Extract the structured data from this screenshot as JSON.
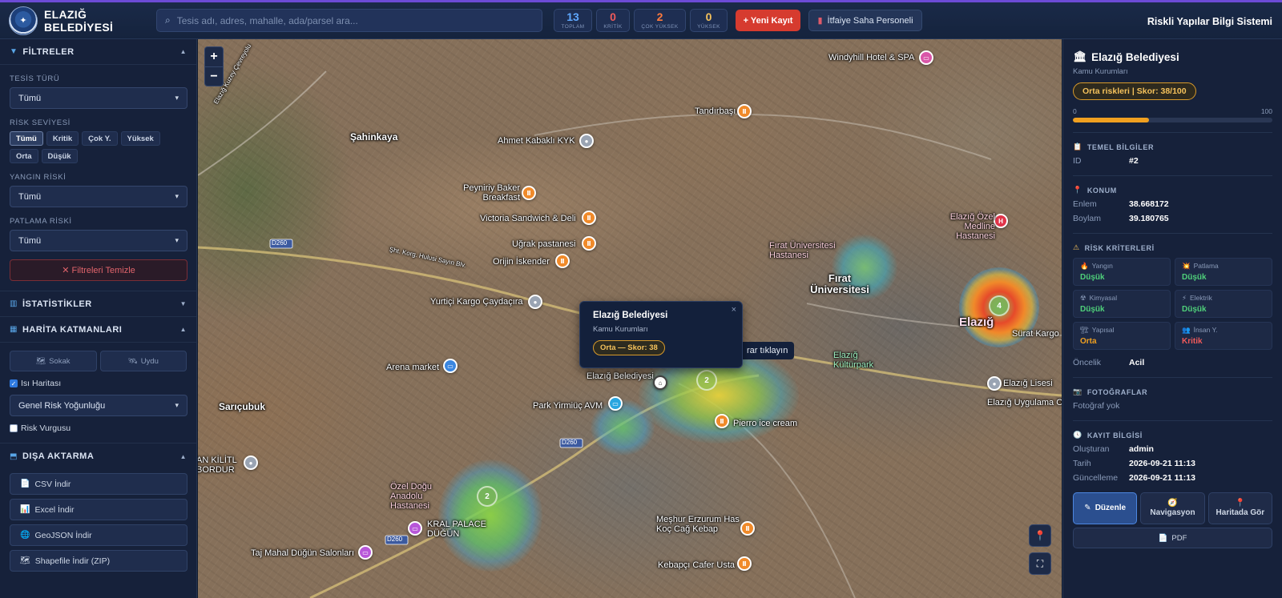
{
  "header": {
    "brand": "ELAZIĞ BELEDİYESİ",
    "search_placeholder": "Tesis adı, adres, mahalle, ada/parsel ara...",
    "stats": [
      {
        "value": "13",
        "label": "TOPLAM",
        "color": "#5fa8ff"
      },
      {
        "value": "0",
        "label": "KRİTİK",
        "color": "#f05a5a"
      },
      {
        "value": "2",
        "label": "ÇOK YÜKSEK",
        "color": "#ff7a3d"
      },
      {
        "value": "0",
        "label": "YÜKSEK",
        "color": "#f5c25c"
      }
    ],
    "new_record": "+ Yeni Kayıt",
    "staff_button": "İtfaiye Saha Personeli",
    "app_title": "Riskli Yapılar Bilgi Sistemi"
  },
  "sidebar": {
    "filters": {
      "title": "FİLTRELER",
      "facility_type_label": "TESİS TÜRÜ",
      "facility_type_value": "Tümü",
      "risk_level_label": "RİSK SEVİYESİ",
      "risk_levels": [
        "Tümü",
        "Kritik",
        "Çok Y.",
        "Yüksek",
        "Orta",
        "Düşük"
      ],
      "fire_risk_label": "YANGIN RİSKİ",
      "fire_risk_value": "Tümü",
      "explosion_risk_label": "PATLAMA RİSKİ",
      "explosion_risk_value": "Tümü",
      "clear_button": "✕ Filtreleri Temizle"
    },
    "statistics_title": "İSTATİSTİKLER",
    "layers": {
      "title": "HARİTA KATMANLARI",
      "street_button": "Sokak",
      "satellite_button": "Uydu",
      "heatmap_label": "Isı Haritası",
      "heatmap_checked": true,
      "heatmap_mode": "Genel Risk Yoğunluğu",
      "risk_emphasis_label": "Risk Vurgusu",
      "risk_emphasis_checked": false
    },
    "export": {
      "title": "DIŞA AKTARMA",
      "buttons": [
        "CSV İndir",
        "Excel İndir",
        "GeoJSON İndir",
        "Shapefile İndir (ZIP)"
      ]
    }
  },
  "map": {
    "labels": [
      "Windyhill Hotel & SPA",
      "Tandırbaşı",
      "Şahinkaya",
      "Ahmet Kabaklı KYK",
      "Peyniriy Baker Breakfast",
      "Victoria Sandwich & Deli",
      "Uğrak pastanesi",
      "Orijin İskender",
      "Yurtiçi Kargo Çaydaçıra",
      "Elazığ Özel Medline Hastanesi",
      "Fırat Üniversitesi Hastanesi",
      "Fırat Üniversitesi",
      "Arena market",
      "Elazığ Belediyesi",
      "Elazığ Kültürpark",
      "Elazığ Lisesi",
      "Elazığ Uygulama Ote",
      "Sürat Kargo",
      "Park Yirmiüç AVM",
      "Pierro ice cream",
      "Sarıçubuk",
      "AN KİLİTL BORDUR",
      "Özel Doğu Anadolu Hastanesi",
      "KRAL PALACE DÜĞÜN",
      "Taj Mahal Düğün Salonları",
      "Meşhur Erzurum Has Koç Cağ Kebap",
      "Kebapçı Cafer Usta",
      "Elazığ Kuzey Çevreyolu",
      "Elazığ",
      "Şht. Korg. Hulusi Sayın Blv."
    ],
    "clusters": [
      "2",
      "4",
      "2"
    ],
    "road_shields": [
      "D260",
      "D260",
      "D260"
    ],
    "zoom_in": "+",
    "zoom_out": "−",
    "popup": {
      "title": "Elazığ Belediyesi",
      "subtitle": "Kamu Kurumları",
      "badge": "Orta — Skor: 38",
      "close": "×"
    },
    "hover_hint": "rar tıklayın"
  },
  "detail": {
    "title": "Elazığ Belediyesi",
    "category": "Kamu Kurumları",
    "risk_badge": "Orta riskleri  |  Skor: 38/100",
    "score_min": "0",
    "score_max": "100",
    "score_fraction": 0.38,
    "basic_title": "TEMEL BİLGİLER",
    "id_label": "ID",
    "id_value": "#2",
    "location_title": "KONUM",
    "lat_label": "Enlem",
    "lat_value": "38.668172",
    "lon_label": "Boylam",
    "lon_value": "39.180765",
    "criteria_title": "RİSK KRİTERLERİ",
    "criteria": [
      {
        "label": "Yangın",
        "value": "Düşük",
        "level": "green",
        "icon": "fire-icon",
        "glyph": "🔥"
      },
      {
        "label": "Patlama",
        "value": "Düşük",
        "level": "green",
        "icon": "explosion-icon",
        "glyph": "💥"
      },
      {
        "label": "Kimyasal",
        "value": "Düşük",
        "level": "green",
        "icon": "chemical-icon",
        "glyph": "☢"
      },
      {
        "label": "Elektrik",
        "value": "Düşük",
        "level": "green",
        "icon": "electric-icon",
        "glyph": "⚡"
      },
      {
        "label": "Yapısal",
        "value": "Orta",
        "level": "orange",
        "icon": "structure-icon",
        "glyph": "🏗"
      },
      {
        "label": "İnsan Y.",
        "value": "Kritik",
        "level": "red",
        "icon": "people-icon",
        "glyph": "👥"
      }
    ],
    "priority_label": "Öncelik",
    "priority_value": "Acil",
    "photos_title": "FOTOĞRAFLAR",
    "photos_empty": "Fotoğraf yok",
    "record_title": "KAYIT BİLGİSİ",
    "created_by_label": "Oluşturan",
    "created_by_value": "admin",
    "date_label": "Tarih",
    "date_value": "2026-09-21 11:13",
    "updated_label": "Güncelleme",
    "updated_value": "2026-09-21 11:13",
    "edit_button": "Düzenle",
    "navigation_button": "Navigasyon",
    "map_view_button": "Haritada Gör",
    "pdf_button": "PDF"
  }
}
